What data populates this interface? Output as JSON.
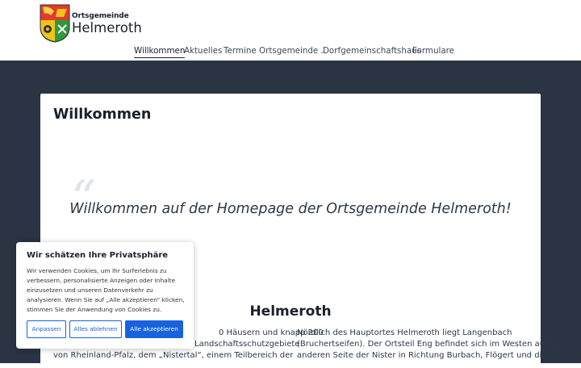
{
  "header": {
    "logo_small": "Ortsgemeinde",
    "logo_big": "Helmeroth"
  },
  "nav": {
    "items": [
      "Willkommen",
      "Aktuelles",
      "Termine",
      "Ortsgemeinde",
      "Dorfgemeinschaftshaus",
      "Formulare"
    ],
    "active": "Willkommen"
  },
  "main": {
    "page_title": "Willkommen",
    "quote": "Willkommen auf der Homepage der Ortsgemeinde Helmeroth!",
    "section_title": "Helmeroth",
    "left_lines": [
      "0 Häusern und knapp 200",
      "Landschaftsschutzgebiete",
      "von Rheinland-Pfalz, dem „Nistertal“, einem Teilbereich der"
    ],
    "right_lines": [
      "Nördlich des Hauptortes Helmeroth liegt Langenbach",
      "(Bruchertseifen). Der Ortsteil Eng befindet sich im Westen auf der",
      "anderen Seite der Nister in Richtung Burbach, Flögert und die"
    ]
  },
  "cookie": {
    "title": "Wir schätzen Ihre Privatsphäre",
    "text": "Wir verwenden Cookies, um Ihr Surferlebnis zu verbessern, personalisierte Anzeigen oder Inhalte einzusetzen und unseren Datenverkehr zu analysieren. Wenn Sie auf „Alle akzeptieren“ klicken, stimmen Sie der Anwendung von Cookies zu.",
    "btn_customize": "Anpassen",
    "btn_reject": "Alles ablehnen",
    "btn_accept": "Alle akzeptieren"
  },
  "colors": {
    "band": "#2a3442",
    "accent": "#1863dc"
  }
}
